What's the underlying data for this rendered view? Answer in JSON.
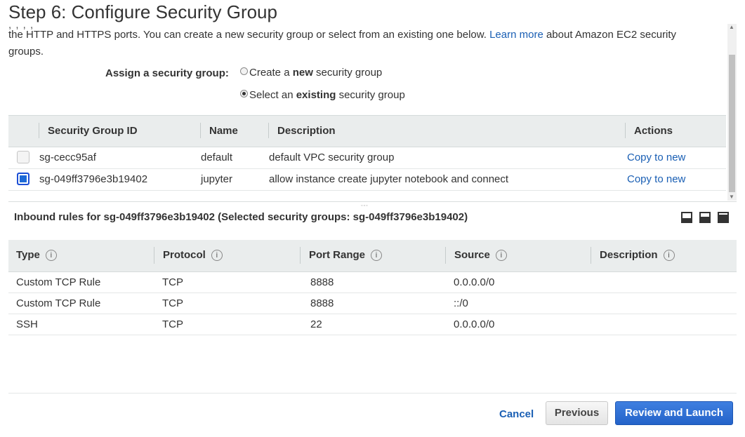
{
  "page_title": "Step 6: Configure Security Group",
  "intro": {
    "cutoff_text": "          ,  ,                        ,                             ,",
    "text_before_link": "the HTTP and HTTPS ports. You can create a new security group or select from an existing one below. ",
    "link": "Learn more",
    "text_after_link": " about Amazon EC2 security groups."
  },
  "assign": {
    "label": "Assign a security group:",
    "option_new": {
      "pre": "Create a ",
      "bold": "new",
      "post": " security group",
      "checked": false
    },
    "option_existing": {
      "pre": "Select an ",
      "bold": "existing",
      "post": " security group",
      "checked": true
    }
  },
  "sg_table": {
    "headers": {
      "id": "Security Group ID",
      "name": "Name",
      "description": "Description",
      "actions": "Actions"
    },
    "rows": [
      {
        "checked": false,
        "id": "sg-cecc95af",
        "name": "default",
        "description": "default VPC security group",
        "action": "Copy to new"
      },
      {
        "checked": true,
        "id": "sg-049ff3796e3b19402",
        "name": "jupyter",
        "description": "allow instance create jupyter notebook and connect",
        "action": "Copy to new"
      }
    ]
  },
  "inbound": {
    "title": "Inbound rules for sg-049ff3796e3b19402 (Selected security groups: sg-049ff3796e3b19402)",
    "headers": {
      "type": "Type",
      "protocol": "Protocol",
      "port_range": "Port Range",
      "source": "Source",
      "description": "Description"
    },
    "info_glyph": "i",
    "rows": [
      {
        "type": "Custom TCP Rule",
        "protocol": "TCP",
        "port_range": "8888",
        "source": "0.0.0.0/0",
        "description": ""
      },
      {
        "type": "Custom TCP Rule",
        "protocol": "TCP",
        "port_range": "8888",
        "source": "::/0",
        "description": ""
      },
      {
        "type": "SSH",
        "protocol": "TCP",
        "port_range": "22",
        "source": "0.0.0.0/0",
        "description": ""
      }
    ]
  },
  "layout_icons": [
    "layout-bottom-icon",
    "layout-split-icon",
    "layout-top-icon"
  ],
  "footer": {
    "cancel": "Cancel",
    "previous": "Previous",
    "review_launch": "Review and Launch"
  },
  "colors": {
    "link": "#1a5fb4",
    "primary_button": "#2463c9",
    "header_bg": "#eaeded"
  }
}
